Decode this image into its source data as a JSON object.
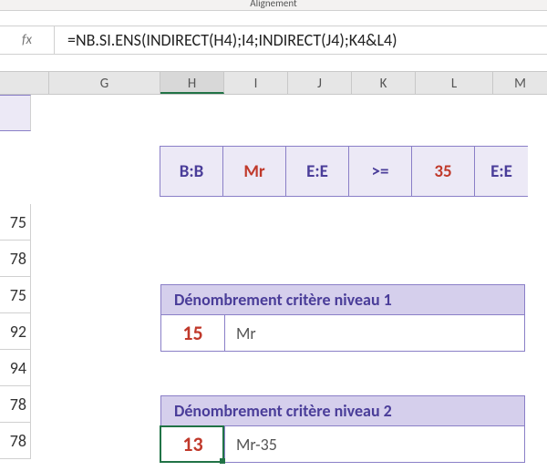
{
  "ribbon": {
    "group_label": "Alignement"
  },
  "formula_bar": {
    "fx": "fx",
    "formula": "=NB.SI.ENS(INDIRECT(H4);I4;INDIRECT(J4);K4&L4)"
  },
  "columns": [
    "G",
    "H",
    "I",
    "J",
    "K",
    "L",
    "M"
  ],
  "active_column_index": 1,
  "left_values": [
    "75",
    "78",
    "75",
    "92",
    "94",
    "78",
    "78"
  ],
  "params": [
    {
      "text": "B:B",
      "red": false
    },
    {
      "text": "Mr",
      "red": true
    },
    {
      "text": "E:E",
      "red": false
    },
    {
      "text": ">=",
      "red": false
    },
    {
      "text": "35",
      "red": true
    },
    {
      "text": "E:E",
      "red": false
    }
  ],
  "block1": {
    "title": "Dénombrement critère niveau 1",
    "value": "15",
    "label": "Mr"
  },
  "block2": {
    "title": "Dénombrement critère niveau 2",
    "value": "13",
    "label": "Mr-35"
  }
}
